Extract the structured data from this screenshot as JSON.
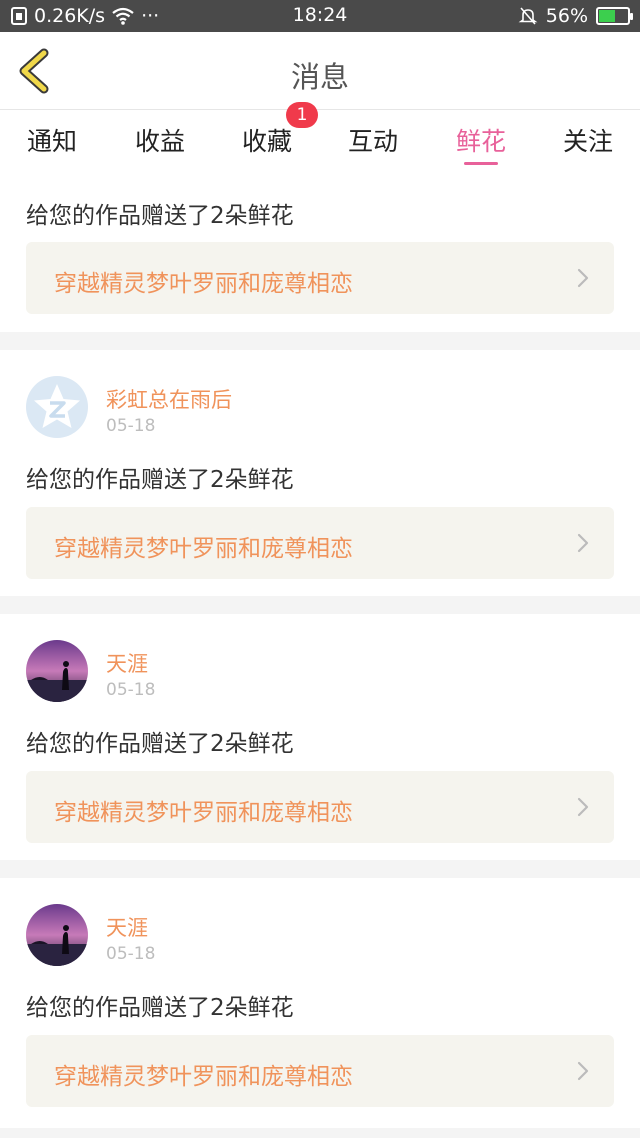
{
  "status_bar": {
    "network_speed": "0.26K/s",
    "dots": "···",
    "time": "18:24",
    "battery_percent": "56%",
    "battery_level": 0.56
  },
  "header": {
    "title": "消息"
  },
  "tabs": [
    {
      "label": "通知"
    },
    {
      "label": "收益"
    },
    {
      "label": "收藏",
      "badge": "1"
    },
    {
      "label": "互动"
    },
    {
      "label": "鲜花",
      "active": true
    },
    {
      "label": "关注"
    }
  ],
  "messages": [
    {
      "text": "给您的作品赠送了2朵鲜花",
      "work_title": "穿越精灵梦叶罗丽和庞尊相恋"
    },
    {
      "username": "彩虹总在雨后",
      "date": "05-18",
      "text": "给您的作品赠送了2朵鲜花",
      "work_title": "穿越精灵梦叶罗丽和庞尊相恋",
      "avatar": "default-avatar-icon"
    },
    {
      "username": "天涯",
      "date": "05-18",
      "text": "给您的作品赠送了2朵鲜花",
      "work_title": "穿越精灵梦叶罗丽和庞尊相恋",
      "avatar": "sunset-photo"
    },
    {
      "username": "天涯",
      "date": "05-18",
      "text": "给您的作品赠送了2朵鲜花",
      "work_title": "穿越精灵梦叶罗丽和庞尊相恋",
      "avatar": "sunset-photo"
    }
  ],
  "colors": {
    "accent_pink": "#e8619a",
    "username_orange": "#f0935b",
    "badge_red": "#f03a4b",
    "back_arrow_yellow": "#f0d84a"
  }
}
